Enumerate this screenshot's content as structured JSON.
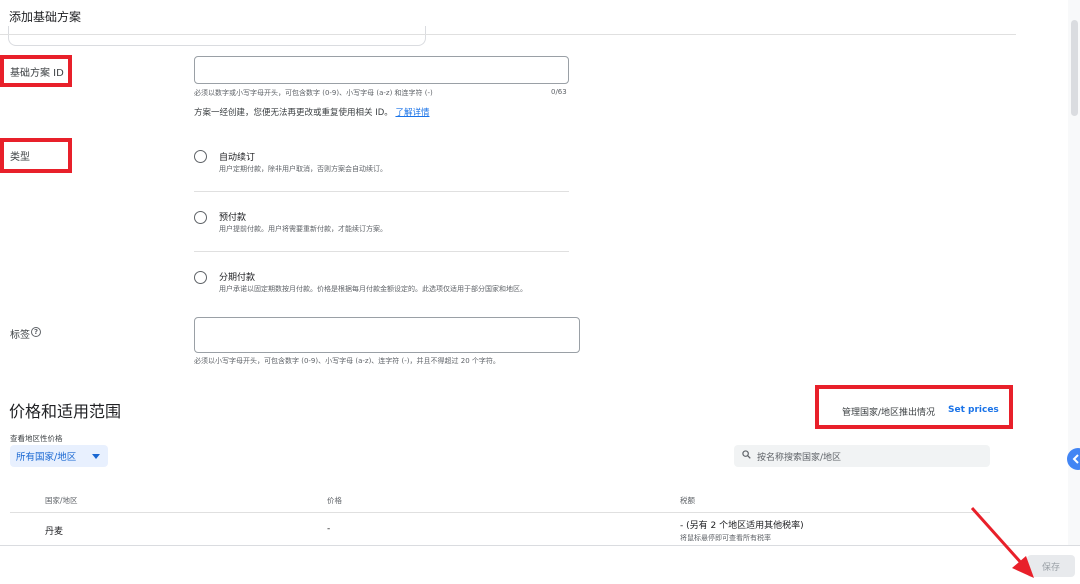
{
  "page": {
    "title": "添加基础方案"
  },
  "plan_id": {
    "label": "基础方案 ID",
    "value": "",
    "hint": "必须以数字或小写字母开头，可包含数字 (0-9)、小写字母 (a-z) 和连字符 (-)",
    "counter": "0/63",
    "note": "方案一经创建，您便无法再更改或重复使用相关 ID。",
    "learn_more": "了解详情"
  },
  "type": {
    "label": "类型",
    "options": [
      {
        "title": "自动续订",
        "desc": "用户定期付款，除非用户取消，否则方案会自动续订。"
      },
      {
        "title": "预付款",
        "desc": "用户提前付款。用户将需要重新付款，才能续订方案。"
      },
      {
        "title": "分期付款",
        "desc": "用户承诺以固定期数按月付款。价格是根据每月付款金额设定的。此选项仅适用于部分国家和地区。"
      }
    ]
  },
  "tags": {
    "label": "标签",
    "help_icon": "help-circle-icon",
    "value": "",
    "hint": "必须以小写字母开头，可包含数字 (0-9)、小写字母 (a-z)、连字符 (-)，并且不得超过 20 个字符。"
  },
  "pricing": {
    "title": "价格和适用范围",
    "manage_label": "管理国家/地区推出情况",
    "set_prices": "Set prices",
    "view_label": "查看地区性价格",
    "region_select": "所有国家/地区",
    "search_placeholder": "按名称搜索国家/地区",
    "columns": [
      "国家/地区",
      "价格",
      "税额"
    ],
    "rows": [
      {
        "country": "丹麦",
        "price": "-",
        "tax": "- (另有 2 个地区适用其他税率)",
        "tax_note": "将鼠标悬停即可查看所有税率"
      }
    ]
  },
  "footer": {
    "save_label": "保存"
  },
  "colors": {
    "accent": "#1a73e8",
    "annotation": "#e8202a"
  }
}
